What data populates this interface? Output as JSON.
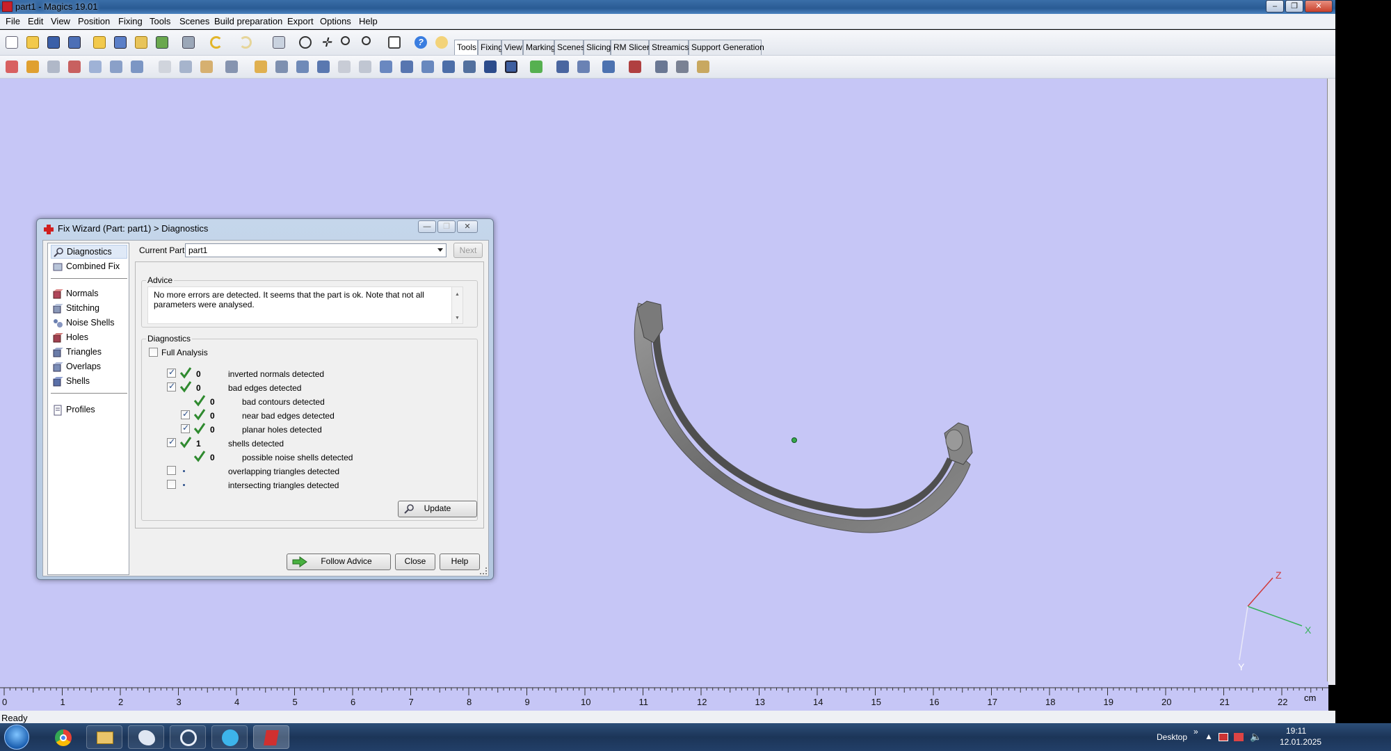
{
  "window": {
    "title": "part1 - Magics 19.01"
  },
  "menu": [
    "File",
    "Edit",
    "View",
    "Position",
    "Fixing",
    "Tools",
    "Scenes",
    "Build preparation",
    "Export",
    "Options",
    "Help"
  ],
  "tabs": [
    "Tools",
    "Fixing",
    "View",
    "Marking",
    "Scenes",
    "Slicing",
    "RM Slicer",
    "Streamics",
    "Support Generation"
  ],
  "active_tab": "Tools",
  "ruler": {
    "ticks": [
      "0",
      "1",
      "2",
      "3",
      "4",
      "5",
      "6",
      "7",
      "8",
      "9",
      "10",
      "11",
      "12",
      "13",
      "14",
      "15",
      "16",
      "17",
      "18",
      "19",
      "20",
      "21",
      "22"
    ],
    "unit": "cm"
  },
  "axes": {
    "x": "X",
    "y": "Y",
    "z": "Z"
  },
  "status": "Ready",
  "taskbar": {
    "desktop_label": "Desktop",
    "time": "19:11",
    "date": "12.01.2025"
  },
  "dialog": {
    "title": "Fix Wizard (Part: part1) > Diagnostics",
    "nav_top": [
      "Diagnostics",
      "Combined Fix"
    ],
    "nav_tools": [
      "Normals",
      "Stitching",
      "Noise Shells",
      "Holes",
      "Triangles",
      "Overlaps",
      "Shells"
    ],
    "nav_bottom": [
      "Profiles"
    ],
    "current_part_label": "Current Part:",
    "current_part_value": "part1",
    "next_label": "Next",
    "advice_title": "Advice",
    "advice_text": "No more errors are detected. It seems that the part is ok. Note that not all parameters were analysed.",
    "diagnostics_title": "Diagnostics",
    "full_analysis_label": "Full Analysis",
    "rows": [
      {
        "count": "0",
        "label": "inverted normals detected"
      },
      {
        "count": "0",
        "label": "bad edges detected"
      },
      {
        "count": "0",
        "label": "bad contours detected"
      },
      {
        "count": "0",
        "label": "near bad edges detected"
      },
      {
        "count": "0",
        "label": "planar holes detected"
      },
      {
        "count": "1",
        "label": "shells detected"
      },
      {
        "count": "0",
        "label": "possible noise shells detected"
      },
      {
        "count": "",
        "label": "overlapping triangles detected"
      },
      {
        "count": "",
        "label": "intersecting triangles detected"
      }
    ],
    "update_label": "Update",
    "follow_advice_label": "Follow Advice",
    "close_label": "Close",
    "help_label": "Help"
  }
}
